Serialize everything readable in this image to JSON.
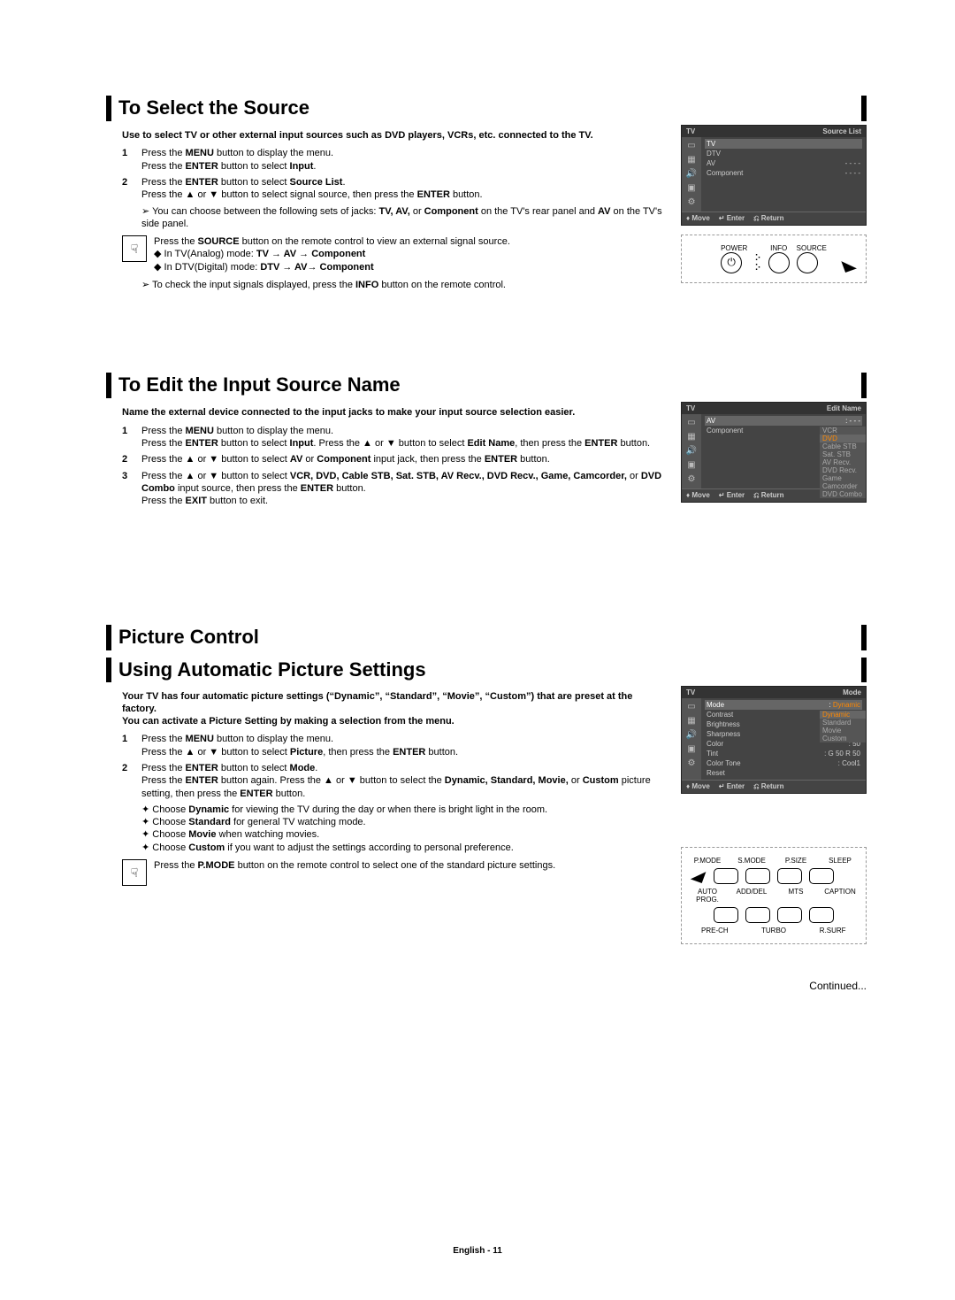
{
  "sections": {
    "select_source": {
      "title": "To Select the Source",
      "intro": "Use to select TV or other external input sources such as DVD players, VCRs, etc. connected to the TV.",
      "step1a": "Press the ",
      "step1a_b1": "MENU",
      "step1a_tail": " button to display the menu.",
      "step1b": "Press the ",
      "step1b_b1": "ENTER",
      "step1b_tail": " button to select ",
      "step1b_b2": "Input",
      "step1b_end": ".",
      "step2a": "Press the ",
      "step2a_b1": "ENTER",
      "step2a_mid": " button to select ",
      "step2a_b2": "Source List",
      "step2a_end": ".",
      "step2b": "Press the ▲ or ▼ button to select signal source, then press the ",
      "step2b_b1": "ENTER",
      "step2b_end": " button.",
      "note1": "You can choose between the following sets of jacks: ",
      "note1_b": "TV, AV, ",
      "note1_mid": "or ",
      "note1_b2": "Component",
      "note1_tail": " on the TV's rear panel and ",
      "note1_b3": "AV",
      "note1_end": " on the TV's side panel.",
      "tip_a": "Press the ",
      "tip_a_b1": "SOURCE",
      "tip_a_tail": " button on the remote control to view an external signal source.",
      "tip_b": "In TV(Analog) mode: ",
      "tip_b_b": "TV → AV → Component",
      "tip_c": "In DTV(Digital) mode: ",
      "tip_c_b": "DTV → AV→ Component",
      "note2": "To check the input signals displayed, press the ",
      "note2_b": "INFO",
      "note2_tail": " button on the remote control."
    },
    "edit_name": {
      "title": "To Edit the Input Source Name",
      "intro": "Name the external device connected to the input jacks to make your input source selection easier.",
      "s1": "Press the ",
      "s1_b1": "MENU",
      "s1_t1": " button to display the menu.",
      "s1b": "Press the ",
      "s1b_b1": "ENTER",
      "s1b_m": " button to select ",
      "s1b_b2": "Input",
      "s1b_t": ". Press the ▲ or ▼ button to select ",
      "s1b_b3": "Edit Name",
      "s1b_e": ", then press the ",
      "s1b_b4": "ENTER",
      "s1b_end": " button.",
      "s2": "Press the ▲ or ▼ button to select ",
      "s2_b1": "AV",
      "s2_m1": " or ",
      "s2_b2": "Component",
      "s2_m2": " input jack, then press the ",
      "s2_b3": "ENTER",
      "s2_e": " button.",
      "s3": "Press the ▲ or ▼ button to select ",
      "s3_b": "VCR, DVD, Cable STB, Sat. STB, AV Recv., DVD Recv., Game, Camcorder,",
      "s3_m": " or ",
      "s3_b2": "DVD Combo",
      "s3_m2": " input source, then press the ",
      "s3_b3": "ENTER",
      "s3_e": " button.",
      "s3x": "Press the ",
      "s3x_b": "EXIT",
      "s3x_e": " button to exit."
    },
    "picture_control": {
      "title": "Picture Control"
    },
    "auto_picture": {
      "title": "Using Automatic Picture Settings",
      "intro1": "Your TV has four automatic picture settings (“Dynamic”, “Standard”, “Movie”, “Custom”) that are preset at the factory.",
      "intro2": "You can activate a Picture Setting by making a selection from the menu.",
      "s1": "Press the ",
      "s1_b": "MENU",
      "s1_t": " button to display the menu.",
      "s1b": "Press the ▲ or ▼ button to select ",
      "s1b_b": "Picture",
      "s1b_m": ", then press the ",
      "s1b_b2": "ENTER",
      "s1b_e": " button.",
      "s2": "Press the ",
      "s2_b": "ENTER",
      "s2_m": " button to select ",
      "s2_b2": "Mode",
      "s2_e": ".",
      "s2b": "Press the ",
      "s2b_b": "ENTER",
      "s2b_m": " button again. Press the ▲ or ▼ button to select the ",
      "s2b_b2": "Dynamic, Standard, Movie,",
      "s2b_m2": " or ",
      "s2b_b3": "Custom",
      "s2b_m3": " picture setting, then press the ",
      "s2b_b4": "ENTER",
      "s2b_e": " button.",
      "bl1": "Choose ",
      "bl1_b": "Dynamic",
      "bl1_t": " for viewing the TV during the day or when there is bright light in the room.",
      "bl2": "Choose ",
      "bl2_b": "Standard",
      "bl2_t": " for general TV watching mode.",
      "bl3": "Choose ",
      "bl3_b": "Movie",
      "bl3_t": " when watching movies.",
      "bl4": "Choose ",
      "bl4_b": "Custom",
      "bl4_t": " if you want to adjust the settings according to personal preference.",
      "tip": "Press the ",
      "tip_b": "P.MODE",
      "tip_t": " button on the remote control to select one of the standard picture settings."
    }
  },
  "osd1": {
    "header_left": "TV",
    "header_right": "Source List",
    "rows": [
      {
        "l": "TV",
        "r": "",
        "sel": true
      },
      {
        "l": "DTV",
        "r": ""
      },
      {
        "l": "AV",
        "r": "- - - -"
      },
      {
        "l": "Component",
        "r": "- - - -"
      }
    ],
    "footer": {
      "move": "Move",
      "enter": "Enter",
      "return": "Return"
    }
  },
  "osd2": {
    "header_left": "TV",
    "header_right": "Edit Name",
    "rows": [
      {
        "l": "AV",
        "r": ": - - -",
        "sel": true
      },
      {
        "l": "Component",
        "r": ":"
      }
    ],
    "sub": [
      "VCR",
      "DVD",
      "Cable STB",
      "Sat. STB",
      "AV Recv.",
      "DVD Recv.",
      "Game",
      "Camcorder",
      "DVD Combo"
    ],
    "footer": {
      "move": "Move",
      "enter": "Enter",
      "return": "Return"
    }
  },
  "osd3": {
    "header_left": "TV",
    "header_right": "Mode",
    "rows": [
      {
        "l": "Mode",
        "r": ": Dynamic",
        "sel": true,
        "hr": true
      },
      {
        "l": "Contrast",
        "r": ""
      },
      {
        "l": "Brightness",
        "r": ""
      },
      {
        "l": "Sharpness",
        "r": ""
      },
      {
        "l": "Color",
        "r": ":         50"
      },
      {
        "l": "Tint",
        "r": ": G 50   R 50"
      },
      {
        "l": "Color Tone",
        "r": ": Cool1"
      },
      {
        "l": "Reset",
        "r": ""
      }
    ],
    "sub": [
      "Dynamic",
      "Standard",
      "Movie",
      "Custom"
    ],
    "footer": {
      "move": "Move",
      "enter": "Enter",
      "return": "Return"
    }
  },
  "remote1": {
    "labels": {
      "power": "POWER",
      "info": "INFO",
      "source": "SOURCE"
    }
  },
  "remote2": {
    "top": [
      "P.MODE",
      "S.MODE",
      "P.SIZE",
      "SLEEP"
    ],
    "mid": [
      "AUTO PROG.",
      "ADD/DEL",
      "MTS",
      "CAPTION"
    ],
    "bot": [
      "PRE-CH",
      "TURBO",
      "R.SURF"
    ]
  },
  "continued": "Continued...",
  "footer": "English - 11"
}
